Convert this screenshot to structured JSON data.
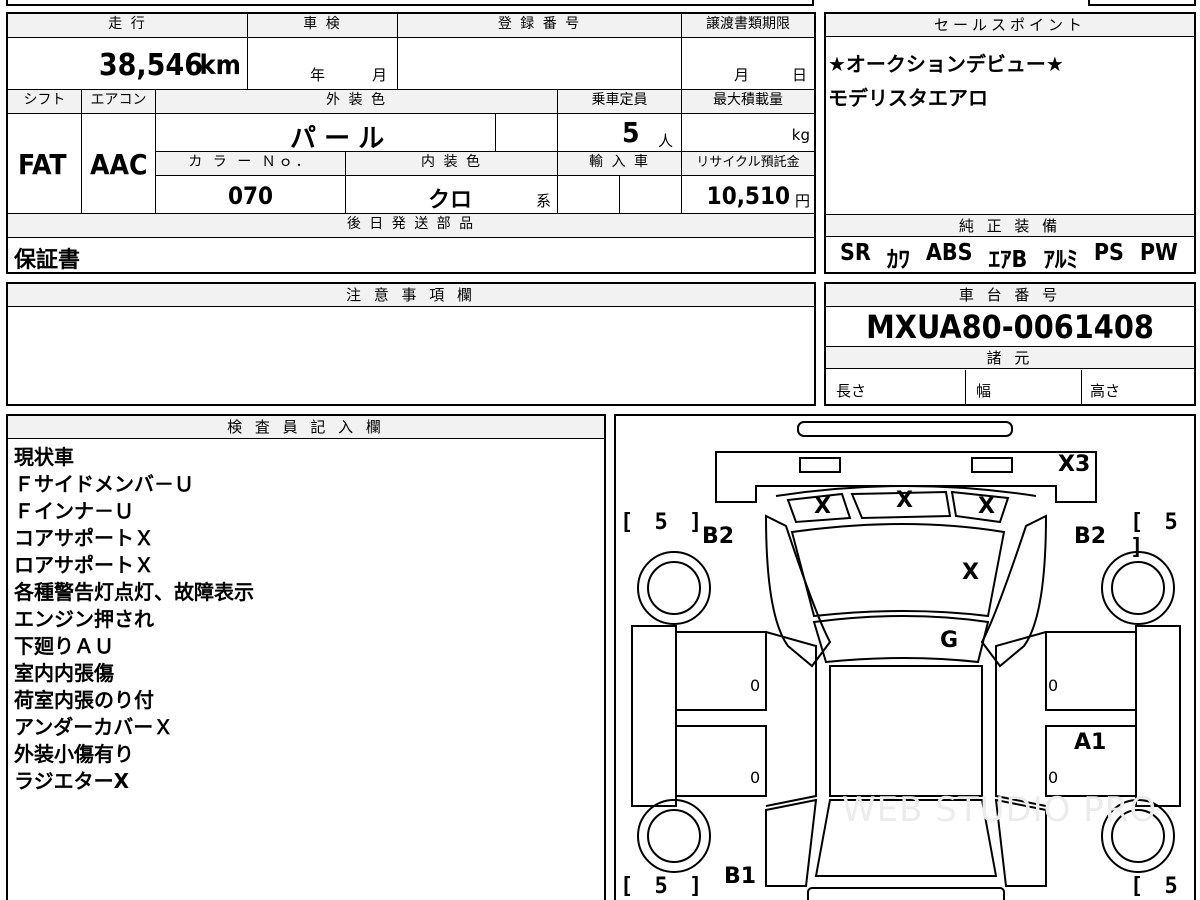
{
  "header_bar": [
    "",
    "",
    "",
    ""
  ],
  "mileage": {
    "label": "走 行",
    "value": "38,546",
    "unit": "km"
  },
  "inspection": {
    "label": "車 検",
    "year": "年",
    "month": "月"
  },
  "registration": {
    "label": "登 録 番 号",
    "value": ""
  },
  "transfer_deadline": {
    "label": "譲渡書類期限",
    "month": "月",
    "day": "日"
  },
  "shift": {
    "label": "シフト",
    "value": "FAT"
  },
  "aircon": {
    "label": "エアコン",
    "value": "AAC"
  },
  "exterior_color": {
    "label": "外 装 色",
    "value": "パ ー ル"
  },
  "capacity": {
    "label": "乗車定員",
    "value": "5",
    "unit": "人"
  },
  "max_load": {
    "label": "最大積載量",
    "unit": "kg"
  },
  "color_no": {
    "label": "カ ラ ー Ｎｏ．",
    "value": "070"
  },
  "interior_color": {
    "label": "内 装 色",
    "value": "クロ",
    "suffix": "系"
  },
  "import": {
    "label": "輸 入 車"
  },
  "recycle": {
    "label": "リサイクル預託金",
    "value": "10,510",
    "unit": "円"
  },
  "parts_shipping": {
    "label": "後 日 発 送 部 品",
    "value": "保証書"
  },
  "sales_points": {
    "label": "セールスポイント",
    "lines": [
      "★オークションデビュー★",
      "モデリスタエアロ"
    ]
  },
  "genuine_equipment": {
    "label": "純 正 装 備",
    "items": [
      "SR",
      "ｶﾜ",
      "ABS",
      "ｴｱB",
      "ｱﾙﾐ",
      "PS",
      "PW"
    ]
  },
  "notes": {
    "label": "注 意 事 項 欄",
    "value": ""
  },
  "chassis_number": {
    "label": "車 台 番 号",
    "value": "MXUA80-0061408"
  },
  "specs": {
    "label": "諸 元",
    "length": "長さ",
    "width": "幅",
    "height": "高さ"
  },
  "inspector": {
    "label": "検 査 員 記 入 欄",
    "lines": [
      "現状車",
      "Ｆサイドメンバ－Ｕ",
      "Ｆインナ－Ｕ",
      "コアサポートＸ",
      "ロアサポートＸ",
      "各種警告灯点灯、故障表示",
      "エンジン押され",
      "下廻りＡＵ",
      "室内内張傷",
      "荷室内張のり付",
      "アンダーカバーＸ",
      "外装小傷有り",
      "ラジエターX"
    ]
  },
  "diagram": {
    "marks": {
      "x3": "X3",
      "ws_left": "X",
      "ws_mid": "X",
      "ws_right": "X",
      "hood": "X",
      "roof": "G",
      "b2_left": "B2",
      "b2_right": "B2",
      "a1": "A1",
      "b1": "B1",
      "o1": "0",
      "o2": "0",
      "o3": "0",
      "o4": "0"
    },
    "tires": {
      "fl": "[ 5 ]",
      "fr": "[ 5 ]",
      "rl": "[ 5 ]",
      "rr": "[ 5 ]"
    },
    "watermark": "WEB STUDIO PRO"
  }
}
